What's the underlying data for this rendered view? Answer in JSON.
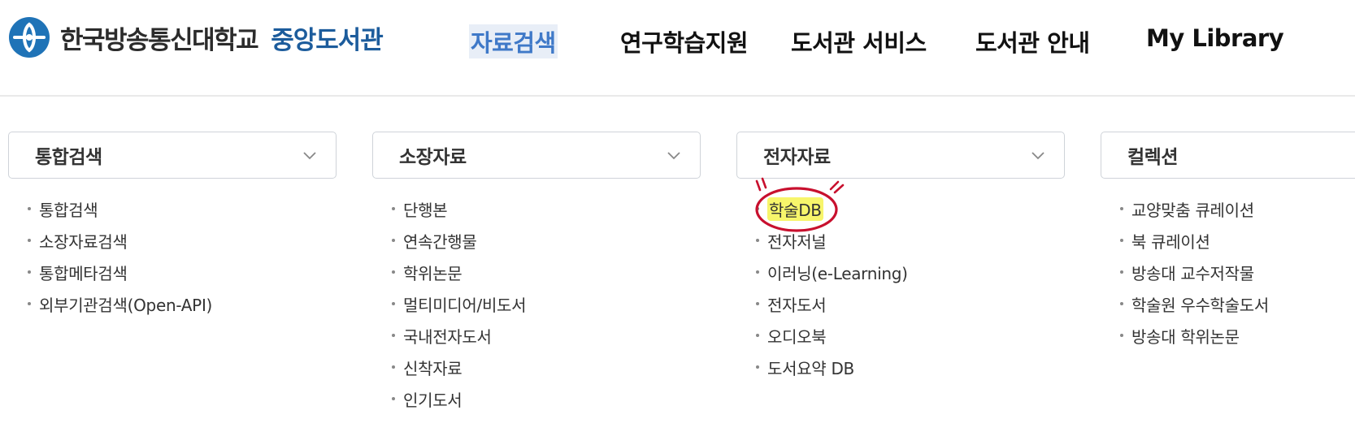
{
  "header": {
    "logo_university": "한국방송통신대학교",
    "logo_library": "중앙도서관",
    "nav": [
      {
        "label": "자료검색",
        "active": true
      },
      {
        "label": "연구학습지원",
        "active": false
      },
      {
        "label": "도서관 서비스",
        "active": false
      },
      {
        "label": "도서관 안내",
        "active": false
      },
      {
        "label": "My Library",
        "active": false
      }
    ]
  },
  "columns": [
    {
      "title": "통합검색",
      "items": [
        "통합검색",
        "소장자료검색",
        "통합메타검색",
        "외부기관검색(Open-API)"
      ]
    },
    {
      "title": "소장자료",
      "items": [
        "단행본",
        "연속간행물",
        "학위논문",
        "멀티미디어/비도서",
        "국내전자도서",
        "신착자료",
        "인기도서"
      ]
    },
    {
      "title": "전자자료",
      "items": [
        "학술DB",
        "전자저널",
        "이러닝(e-Learning)",
        "전자도서",
        "오디오북",
        "도서요약 DB"
      ]
    },
    {
      "title": "컬렉션",
      "items": [
        "교양맞춤 큐레이션",
        "북 큐레이션",
        "방송대 교수저작물",
        "학술원 우수학술도서",
        "방송대 학위논문"
      ]
    }
  ],
  "highlighted_item": "학술DB",
  "colors": {
    "accent": "#3f79c8",
    "logo_blue": "#1c5c9c",
    "annotation_red": "#c8102e",
    "highlight": "#f7f56b"
  },
  "icons": [
    "university-emblem-icon",
    "chevron-down-icon"
  ]
}
